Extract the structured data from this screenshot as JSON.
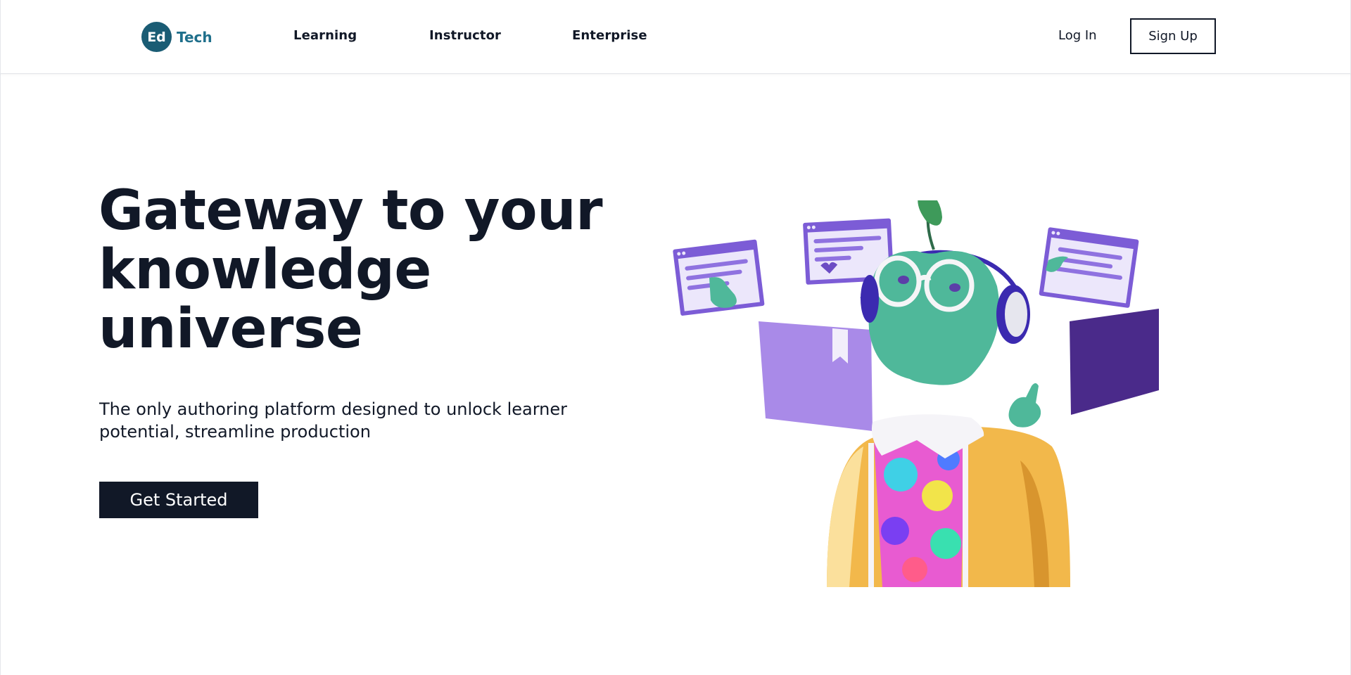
{
  "header": {
    "logo": {
      "badge": "Ed",
      "text": "Tech"
    },
    "nav": [
      {
        "label": "Learning"
      },
      {
        "label": "Instructor"
      },
      {
        "label": "Enterprise"
      }
    ],
    "login_label": "Log In",
    "signup_label": "Sign Up"
  },
  "hero": {
    "title": "Gateway to your knowledge universe",
    "subtitle": "The only authoring platform designed to unlock learner potential, streamline production",
    "cta_label": "Get Started"
  },
  "illustration": {
    "subject": "3D character with apple-shaped green head, round glasses, headphones, yellow jacket and colorful shirt, surrounded by floating purple browser windows and books",
    "colors": {
      "purple_light": "#a98ae8",
      "purple_dark": "#4a2a8a",
      "window_purple": "#7c5cd6",
      "head_green": "#4fb89a",
      "leaf_green": "#3e9a5a",
      "jacket_yellow": "#f2b84b",
      "headphone_indigo": "#3b2ab0"
    }
  }
}
